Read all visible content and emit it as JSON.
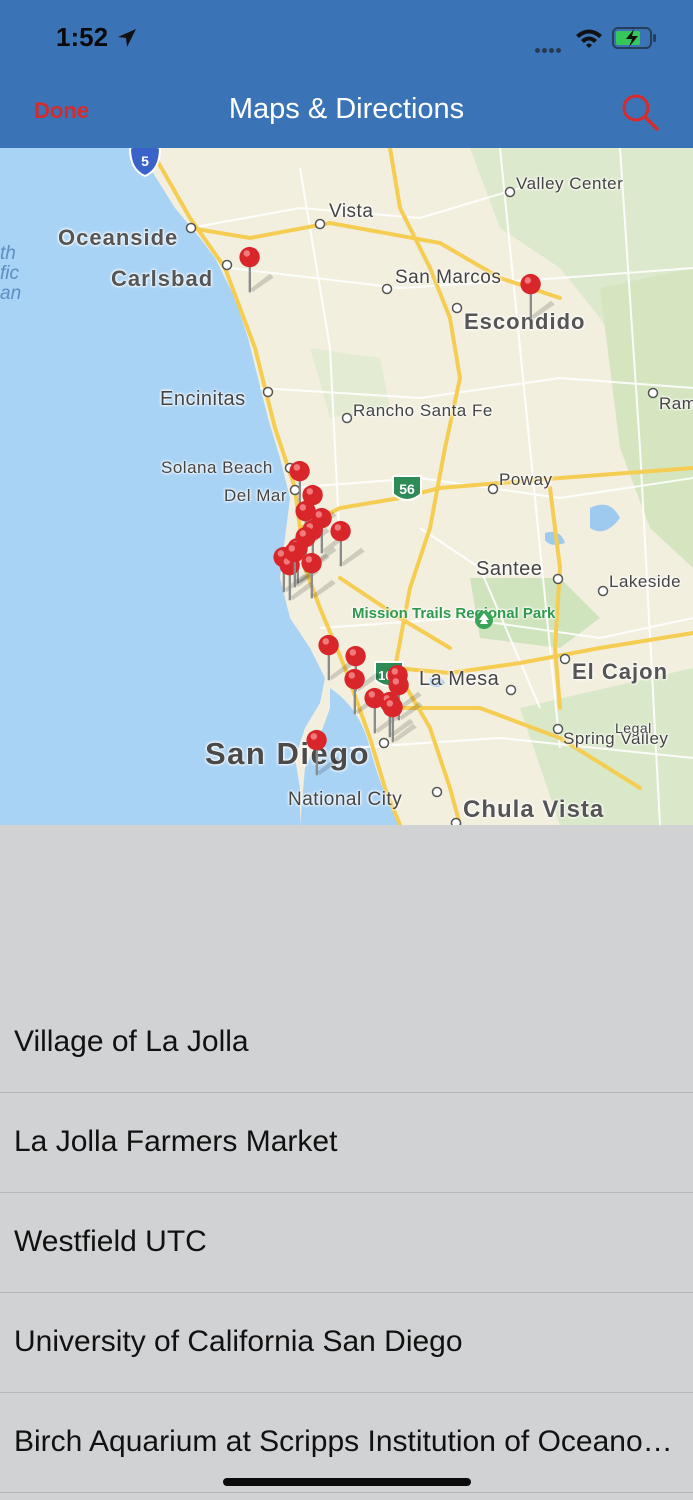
{
  "status_bar": {
    "time": "1:52"
  },
  "nav": {
    "done_label": "Done",
    "title": "Maps & Directions"
  },
  "map": {
    "places": [
      "Oceanside",
      "Vista",
      "Valley Center",
      "Carlsbad",
      "San Marcos",
      "Escondido",
      "Encinitas",
      "Rancho Santa Fe",
      "Ram",
      "Solana Beach",
      "Del Mar",
      "Poway",
      "Santee",
      "Lakeside",
      "Mission Trails Regional Park",
      "El Cajon",
      "La Mesa",
      "Spring Valley",
      "Legal",
      "San Diego",
      "National City",
      "Chula Vista"
    ],
    "water_label": "th\nfic\nan",
    "highway_shields": [
      "5",
      "56",
      "163"
    ],
    "pin_count": 22
  },
  "locations": [
    "Village of La Jolla",
    "La Jolla Farmers Market",
    "Westfield UTC",
    "University of California San Diego",
    "Birch Aquarium at Scripps Institution of Oceanography"
  ]
}
